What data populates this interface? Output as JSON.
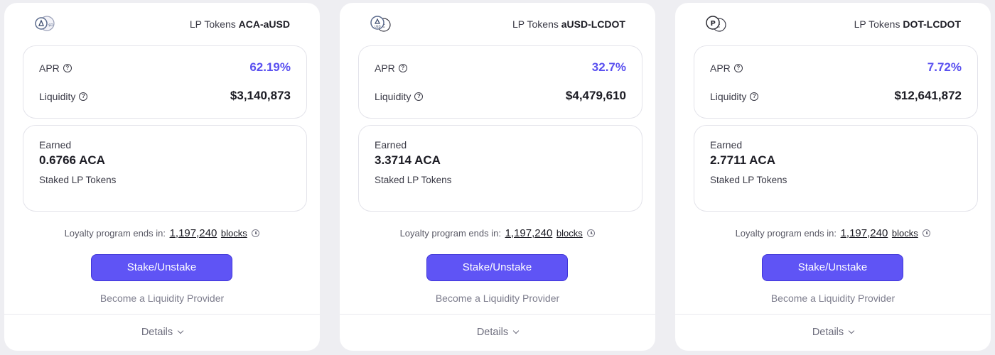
{
  "cards": [
    {
      "lp_prefix": "LP Tokens",
      "pair": "ACA-aUSD",
      "apr_label": "APR",
      "apr_value": "62.19%",
      "liquidity_label": "Liquidity",
      "liquidity_value": "$3,140,873",
      "earned_label": "Earned",
      "earned_value": "0.6766 ACA",
      "staked_label": "Staked LP Tokens",
      "loyalty_text": "Loyalty program ends in:",
      "loyalty_blocks": "1,197,240",
      "loyalty_unit": "blocks",
      "stake_button": "Stake/Unstake",
      "lp_link": "Become a Liquidity Provider",
      "details": "Details",
      "icons": [
        "aca-token-icon",
        "ausd-token-icon"
      ]
    },
    {
      "lp_prefix": "LP Tokens",
      "pair": "aUSD-LCDOT",
      "apr_label": "APR",
      "apr_value": "32.7%",
      "liquidity_label": "Liquidity",
      "liquidity_value": "$4,479,610",
      "earned_label": "Earned",
      "earned_value": "3.3714 ACA",
      "staked_label": "Staked LP Tokens",
      "loyalty_text": "Loyalty program ends in:",
      "loyalty_blocks": "1,197,240",
      "loyalty_unit": "blocks",
      "stake_button": "Stake/Unstake",
      "lp_link": "Become a Liquidity Provider",
      "details": "Details",
      "icons": [
        "ausd-token-icon",
        "lcdot-token-icon"
      ]
    },
    {
      "lp_prefix": "LP Tokens",
      "pair": "DOT-LCDOT",
      "apr_label": "APR",
      "apr_value": "7.72%",
      "liquidity_label": "Liquidity",
      "liquidity_value": "$12,641,872",
      "earned_label": "Earned",
      "earned_value": "2.7711 ACA",
      "staked_label": "Staked LP Tokens",
      "loyalty_text": "Loyalty program ends in:",
      "loyalty_blocks": "1,197,240",
      "loyalty_unit": "blocks",
      "stake_button": "Stake/Unstake",
      "lp_link": "Become a Liquidity Provider",
      "details": "Details",
      "icons": [
        "dot-token-icon",
        "lcdot-token-icon"
      ]
    }
  ],
  "colors": {
    "accent": "#5f54f5",
    "apr": "#5a50f0",
    "background": "#eeeef2"
  }
}
